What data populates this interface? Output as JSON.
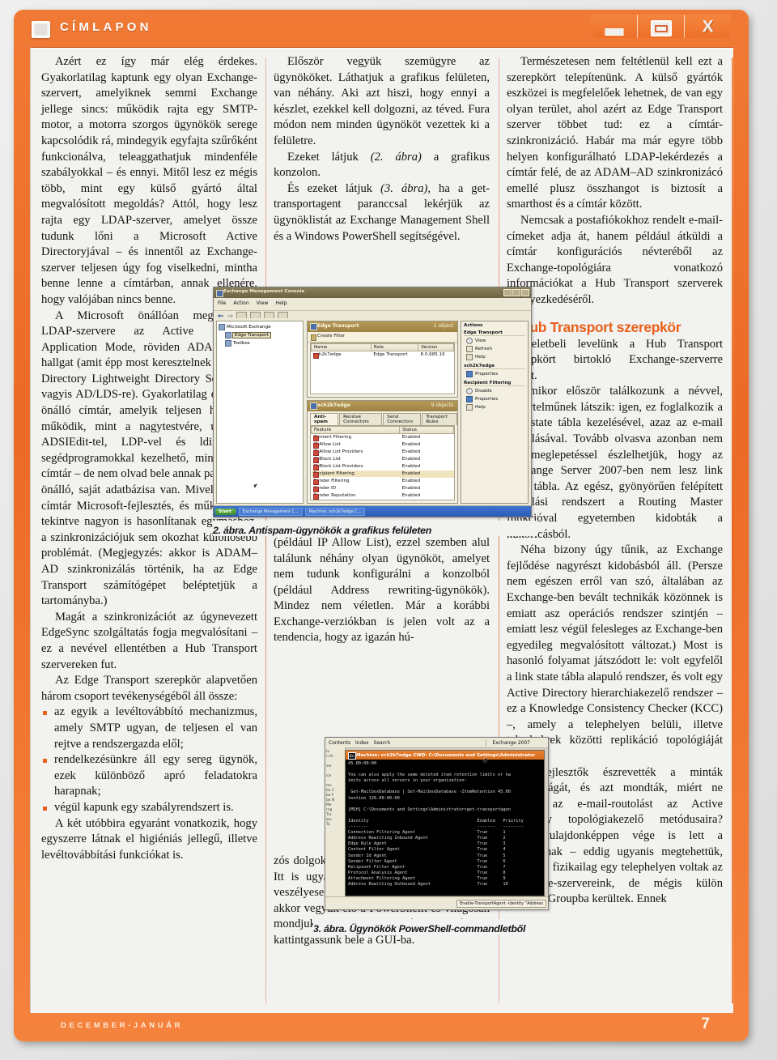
{
  "window": {
    "title": "CÍMLAPON",
    "icon": "window-square-icon",
    "buttons": [
      {
        "name": "minimize",
        "glyph": "minimize-icon"
      },
      {
        "name": "maximize",
        "glyph": "maximize-icon"
      },
      {
        "name": "close",
        "glyph": "X"
      }
    ]
  },
  "footer": {
    "issue": "DECEMBER-JANUÁR",
    "page_number": "7"
  },
  "colors": {
    "accent": "#e8601c",
    "frame": "#ec6b26",
    "paper": "#f2f2f0",
    "text": "#16120f"
  },
  "column1": {
    "paragraphs": [
      "Azért ez így már elég érdekes. Gyakorlatilag kaptunk egy olyan Exchange-szervert, amelyiknek semmi Exchange jellege sincs: működik rajta egy SMTP-motor, a motorra szorgos ügynökök serege kapcsolódik rá, mindegyik egyfajta szűrőként funkcionálva, teleaggathatjuk mindenféle szabályokkal – és ennyi. Mitől lesz ez mégis több, mint egy külső gyártó által megvalósított megoldás? Attól, hogy lesz rajta egy LDAP-szerver, amelyet össze tudunk lőni a Microsoft Active Directoryjával – és innentől az Exchange-szerver teljesen úgy fog viselkedni, mintha benne lenne a címtárban, annak ellenére, hogy valójában nincs benne.",
      "A Microsoft önállóan megvalósított LDAP-szervere az Active Directory Application Mode, röviden ADAM névre hallgat (amit épp most keresztelnek át Active Directory Lightweight Directory Servicesre, vagyis AD/LDS-re). Gyakorlatilag egy kicsi, önálló címtár, amelyik teljesen hasonlóan működik, mint a nagytestvére, ugyanúgy ADSIEdit-tel, LDP-vel és ldifde/csvde segédprogramokkal kezelhető, mint a nagy címtár – de nem olvad bele annak partícióiba, önálló, saját adatbázisa van. Mivel mindkét címtár Microsoft-fejlesztés, és működésüket tekintve nagyon is hasonlítanak egymáshoz, a szinkronizációjuk sem okozhat különösebb problémát. (Megjegyzés: akkor is ADAM–AD szinkronizálás történik, ha az Edge Transport számítógépet beléptetjük a tartományba.)",
      "Magát a szinkronizációt az úgynevezett EdgeSync szolgáltatás fogja megvalósítani – ez a nevével ellentétben a Hub Transport szervereken fut.",
      "Az Edge Transport szerepkör alapvetően három csoport tevékenységéből áll össze:"
    ],
    "bullets": [
      "az egyik a levéltovábbító mechanizmus, amely SMTP ugyan, de teljesen el van rejtve a rendszergazda elől;",
      "rendelkezésünkre áll egy sereg ügynök, ezek különböző apró feladatokra harapnak;",
      "végül kapunk egy szabályrendszert is."
    ],
    "closing": "A két utóbbira egyaránt vonatkozik, hogy egyszerre látnak el higiéniás jellegű, illetve levéltovábbítási funkciókat is."
  },
  "column2": {
    "paragraphs_top": [
      "Először vegyük szemügyre az ügynököket. Láthatjuk a grafikus felületen, van néhány. Aki azt hiszi, hogy ennyi a készlet, ezekkel kell dolgozni, az téved. Fura módon nem minden ügynököt vezettek ki a felületre."
    ],
    "figure_refs": [
      {
        "pre": "Ezeket látjuk ",
        "ital": "(2. ábra)",
        "post": " a grafikus konzolon."
      },
      {
        "pre": "És ezeket látjuk ",
        "ital": "(3. ábra)",
        "post": ", ha a get-transportagent paranccsal lekérjük az ügynöklistát az Exchange Management Shell és a Windows PowerShell segítségével."
      }
    ],
    "paragraphs_mid": [
      "Ha a két képet összehasonlítjuk, feltűnhet, hogy a grafikus felületen akad néhány olyan elem, amelyik tulajdonképpen nem is ügynök (például IP Allow List), ezzel szemben alul találunk néhány olyan ügynököt, amelyet nem tudunk konfigurálni a konzolból (például Address rewriting-ügynökök). Mindez nem véletlen. Már a korábbi Exchange-verziókban is jelen volt az a tendencia, hogy az igazán hú-"
    ],
    "paragraphs_bottom": [
      "zós dolgokat elrejtették az 1.0 adminok elől. Itt is ugyanerről van szó: ha keményebb, veszélyesebb dolgokat akarunk csinálni, akkor vegyük elő a PowerShellt és világosan mondjuk meg, mit is szeretnénk. Csak úgy ne kattintgassunk bele a GUI-ba."
    ]
  },
  "column3": {
    "paragraphs_top": [
      "Természetesen nem feltétlenül kell ezt a szerepkört telepítenünk. A külső gyártók eszközei is megfelelőek lehetnek, de van egy olyan terület, ahol azért az Edge Transport szerver többet tud: ez a címtár-szinkronizáció. Habár ma már egyre több helyen konfigurálható LDAP-lekérdezés a címtár felé, de az ADAM–AD szinkronizácó emellé plusz összhangot is biztosít a smarthost és a címtár között.",
      "Nemcsak a postafiókokhoz rendelt e-mail-címeket adja át, hanem például átküldi a címtár konfigurációs névteréből az Exchange-topológiára vonatkozó információkat a Hub Transport szerverek elhelyezkedéséről."
    ],
    "heading": "A Hub Transport szerepkör",
    "paragraphs_after_heading": [
      "Képzeletbeli levelünk a Hub Transport szerepkört birtokló Exchange-szerverre került.",
      "Amikor először találkozunk a névvel, egyértelműnek látszik: igen, ez foglalkozik a link state tábla kezelésével, azaz az e-mail routolásával. Tovább olvasva azonban nem kis meglepetéssel észlelhetjük, hogy az Exchange Server 2007-ben nem lesz link state tábla. Az egész, gyönyörűen felépített routolási rendszert a Routing Master funkcióval egyetemben kidobták a kukoricásból.",
      "Néha bizony úgy tűnik, az Exchange fejlődése nagyrészt kidobásból áll. (Persze nem egészen erről van szó, általában az Exchange-ben bevált technikák közönnek is emiatt asz operációs rendszer szintjén – emiatt lesz végül felesleges az Exchange-ben egyedileg megvalósított változat.) Most is hasonló folyamat játszódott le: volt egyfelől a link state tábla alapuló rendszer, és volt egy Active Directory hierarchiakezelő rendszer – ez a Knowledge Consistency Checker (KCC) –, amely a telephelyen belüli, illetve telephelyek közötti replikáció topológiáját kezelte.",
      "A fejlesztők észrevették a minták hasonlóságát, és azt mondták, miért ne bízzuk az e-mail-routolást az Active Directory topológiakezelő metódusaira? Ezzel tulajdonképpen vége is lett a sunyításnak – eddig ugyanis megtehettük, hogy bár fizikailag egy telephelyen voltak az Exchange-szervereink, de mégis külön Routing Groupba kerültek. Ennek"
    ]
  },
  "figure2": {
    "caption": "2. ábra. Antispam-ügynökök a grafikus felületen",
    "window_title": "Exchange Management Console",
    "menu": [
      "File",
      "Action",
      "View",
      "Help"
    ],
    "tree": [
      {
        "label": "Microsoft Exchange",
        "selected": false
      },
      {
        "label": "Edge Transport",
        "selected": true
      },
      {
        "label": "Toolbox",
        "selected": false
      }
    ],
    "top_panel": {
      "title": "Edge Transport",
      "count": "1 object",
      "filter_label": "Create Filter",
      "columns": [
        "Name",
        "Role",
        "Version"
      ],
      "rows": [
        {
          "name": "xch2k7edge",
          "role": "Edge Transport",
          "version": "8.0.685.16"
        }
      ]
    },
    "bottom_panel": {
      "title": "xch2k7edge",
      "count": "9 objects",
      "tabs": [
        "Anti-spam",
        "Receive Connectors",
        "Send Connectors",
        "Transport Rules"
      ],
      "active_tab": "Anti-spam",
      "columns": [
        "Feature",
        "Status"
      ],
      "rows": [
        {
          "feature": "Content Filtering",
          "status": "Enabled",
          "highlighted": false
        },
        {
          "feature": "IP Allow List",
          "status": "Enabled",
          "highlighted": false
        },
        {
          "feature": "IP Allow List Providers",
          "status": "Enabled",
          "highlighted": false
        },
        {
          "feature": "IP Block List",
          "status": "Enabled",
          "highlighted": false
        },
        {
          "feature": "IP Block List Providers",
          "status": "Enabled",
          "highlighted": false
        },
        {
          "feature": "Recipient Filtering",
          "status": "Enabled",
          "highlighted": true
        },
        {
          "feature": "Sender Filtering",
          "status": "Enabled",
          "highlighted": false
        },
        {
          "feature": "Sender ID",
          "status": "Enabled",
          "highlighted": false
        },
        {
          "feature": "Sender Reputation",
          "status": "Enabled",
          "highlighted": false
        }
      ]
    },
    "actions_pane": {
      "title": "Actions",
      "group1": {
        "header": "Edge Transport",
        "items": [
          "View",
          "Refresh",
          "Help"
        ]
      },
      "group2": {
        "header": "xch2k7edge",
        "items": [
          "Properties"
        ]
      },
      "group3": {
        "header": "Recipient Filtering",
        "items": [
          "Disable",
          "Properties",
          "Help"
        ]
      }
    },
    "taskbar": {
      "start": "Start",
      "items": [
        "Exchange Management C...",
        "Machine: xch2k7edge C..."
      ]
    }
  },
  "figure3": {
    "caption": "3. ábra. Ügynökök PowerShell-commandletből",
    "helpbar": [
      "Contents",
      "Index",
      "Search"
    ],
    "helpbar_right": "Exchange 2007",
    "window_title": "Machine: xch2k7edge CWD: C:\\Documents and Settings\\Administrator",
    "console_text": "45.00:00:00\n\nYou can also apply the same deleted item retention limits or na\nimits across all servers in your organization:\n\n Get-MailboxDatabase | Set-MailboxDatabase -ItemRetention 45.00\ntention 120.00:00:00\n\n[MSH] C:\\Documents and Settings\\Administrator>get-transportagen\n\nIdentity                                          Enabled   Priority\n--------                                          -------   --------\nConnection Filtering Agent                        True      1\nAddress Rewriting Inbound Agent                   True      2\nEdge Rule Agent                                   True      3\nContent Filter Agent                              True      4\nSender Id Agent                                   True      5\nSender Filter Agent                               True      6\nRecipient Filter Agent                            True      7\nProtocol Analysis Agent                           True      8\nAttachment Filtering Agent                        True      9\nAddress Rewriting Outbound Agent                  True      10\n\n\n[MSH] C:\\Documents and Settings\\Administrator>_",
    "agents": [
      {
        "identity": "Connection Filtering Agent",
        "enabled": "True",
        "priority": "1"
      },
      {
        "identity": "Address Rewriting Inbound Agent",
        "enabled": "True",
        "priority": "2"
      },
      {
        "identity": "Edge Rule Agent",
        "enabled": "True",
        "priority": "3"
      },
      {
        "identity": "Content Filter Agent",
        "enabled": "True",
        "priority": "4"
      },
      {
        "identity": "Sender Id Agent",
        "enabled": "True",
        "priority": "5"
      },
      {
        "identity": "Sender Filter Agent",
        "enabled": "True",
        "priority": "6"
      },
      {
        "identity": "Recipient Filter Agent",
        "enabled": "True",
        "priority": "7"
      },
      {
        "identity": "Protocol Analysis Agent",
        "enabled": "True",
        "priority": "8"
      },
      {
        "identity": "Attachment Filtering Agent",
        "enabled": "True",
        "priority": "9"
      },
      {
        "identity": "Address Rewriting Outbound Agent",
        "enabled": "True",
        "priority": "10"
      }
    ],
    "bottom_chunk": "Enable-TransportAgent -Identity \"Address"
  }
}
